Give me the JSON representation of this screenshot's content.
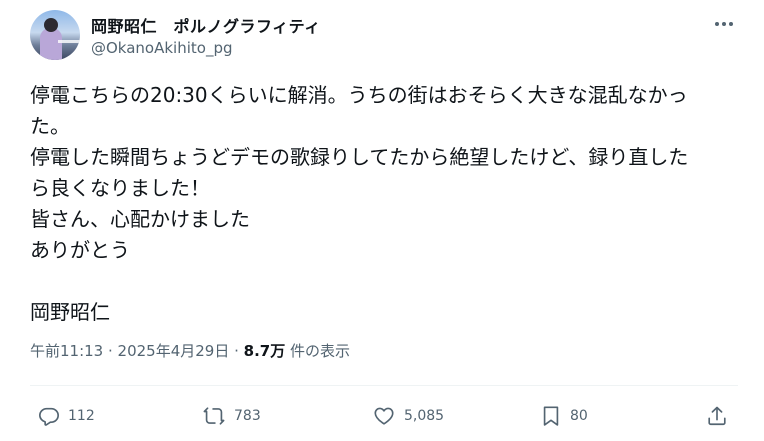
{
  "author": {
    "display_name": "岡野昭仁　ポルノグラフィティ",
    "handle": "@OkanoAkihito_pg"
  },
  "post": {
    "lines": [
      "停電こちらの20:30くらいに解消。うちの街はおそらく大きな混乱なかっ",
      "た。",
      "停電した瞬間ちょうどデモの歌録りしてたから絶望したけど、録り直した",
      "ら良くなりました！",
      "皆さん、心配かけました",
      "ありがとう",
      "",
      "岡野昭仁"
    ]
  },
  "meta": {
    "time": "午前11:13",
    "sep1": " · ",
    "date": "2025年4月29日",
    "sep2": " · ",
    "views_count": "8.7万",
    "views_label": " 件の表示"
  },
  "actions": {
    "replies": "112",
    "reposts": "783",
    "likes": "5,085",
    "bookmarks": "80"
  },
  "icons": {
    "more": "more-horizontal-icon",
    "reply": "reply-icon",
    "repost": "repost-icon",
    "like": "heart-icon",
    "bookmark": "bookmark-icon",
    "share": "share-icon"
  },
  "colors": {
    "text": "#0f1419",
    "secondary": "#536471",
    "divider": "#eff3f4"
  }
}
